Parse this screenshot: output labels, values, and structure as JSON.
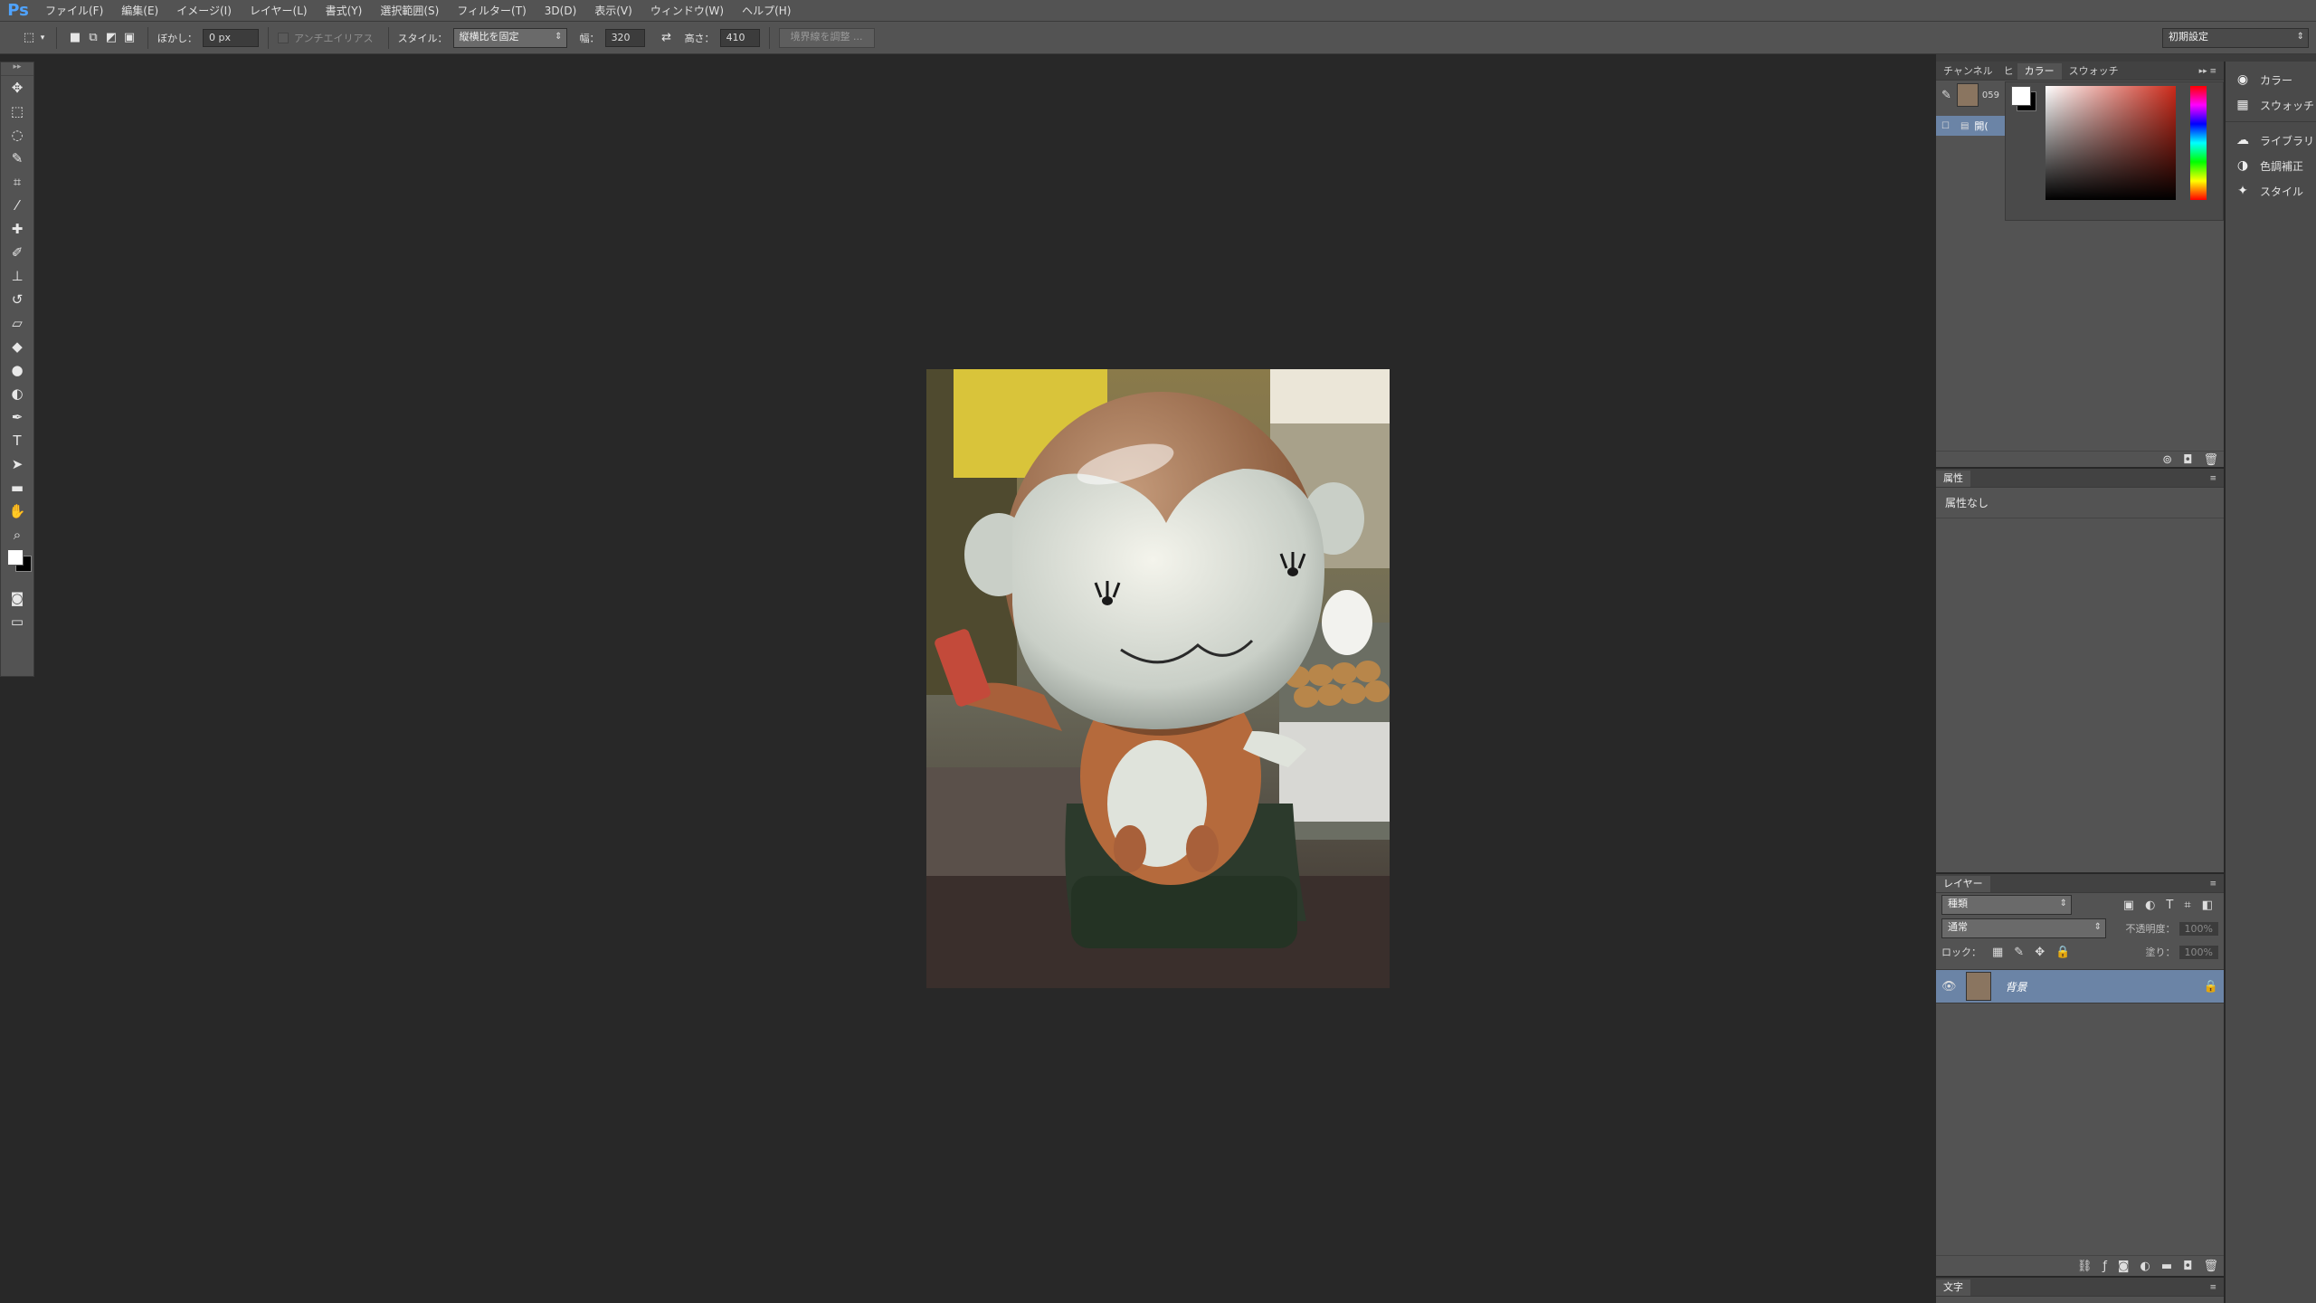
{
  "app": {
    "logo": "Ps"
  },
  "menu": [
    "ファイル(F)",
    "編集(E)",
    "イメージ(I)",
    "レイヤー(L)",
    "書式(Y)",
    "選択範囲(S)",
    "フィルター(T)",
    "3D(D)",
    "表示(V)",
    "ウィンドウ(W)",
    "ヘルプ(H)"
  ],
  "options": {
    "feather_label": "ぼかし：",
    "feather_value": "0 px",
    "antialias_label": "アンチエイリアス",
    "style_label": "スタイル：",
    "style_value": "縦横比を固定",
    "width_label": "幅：",
    "width_value": "320",
    "height_label": "高さ：",
    "height_value": "410",
    "refine_edge": "境界線を調整 ...",
    "workspace": "初期設定"
  },
  "channels_panel": {
    "tabs": [
      "チャンネル",
      "ヒ",
      "カラー",
      "スウォッチ"
    ],
    "row1_label": "059",
    "row2_label": "開("
  },
  "side_panels": [
    "カラー",
    "スウォッチ",
    "ライブラリ",
    "色調補正",
    "スタイル"
  ],
  "properties": {
    "title": "属性",
    "content": "属性なし"
  },
  "layers": {
    "title": "レイヤー",
    "filter_kind": "種類",
    "blend_mode": "通常",
    "opacity_label": "不透明度：",
    "opacity_value": "100%",
    "lock_label": "ロック：",
    "fill_label": "塗り：",
    "fill_value": "100%",
    "items": [
      {
        "name": "背景"
      }
    ]
  },
  "type_panel": {
    "title": "文字"
  },
  "colors": {
    "menubar": "#535353",
    "panel": "#535353",
    "canvas_bg": "#282828",
    "layer_selected": "#6b84a6",
    "foreground": "#ffffff",
    "background": "#000000"
  }
}
